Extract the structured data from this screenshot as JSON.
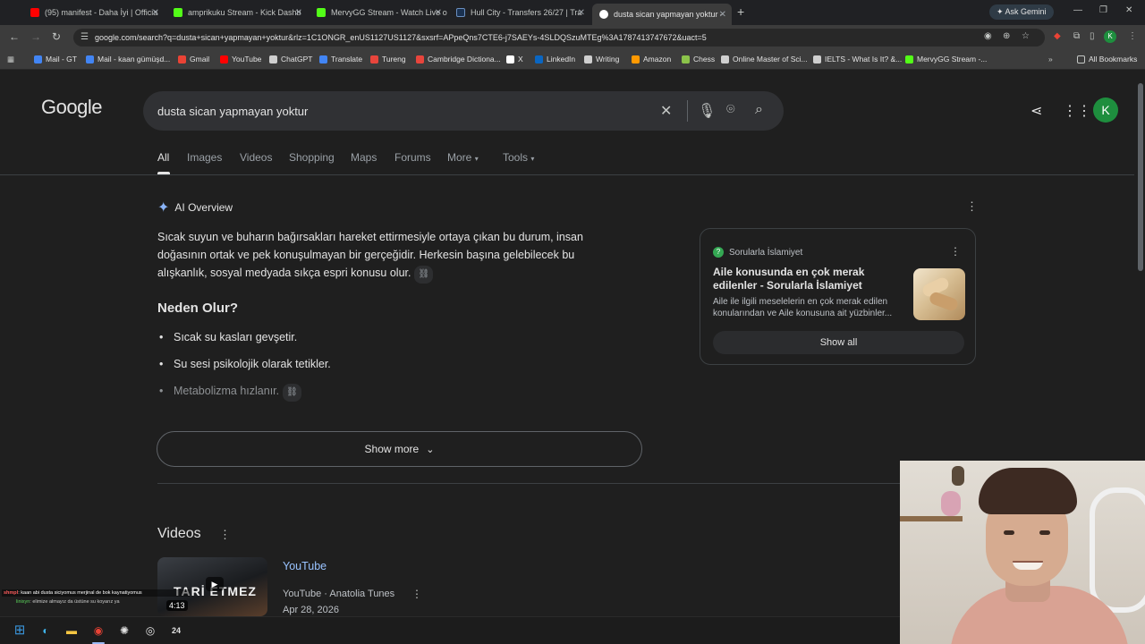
{
  "browser": {
    "tabs": [
      {
        "title": "(95) manifest - Daha İyi | Officia",
        "favicon_color": "#ff0000"
      },
      {
        "title": "amprikuku Stream - Kick Dashb",
        "favicon_color": "#53fc18"
      },
      {
        "title": "MervyGG Stream - Watch Live o",
        "favicon_color": "#53fc18"
      },
      {
        "title": "Hull City - Transfers 26/27 | Tra",
        "favicon_color": "#1a3150"
      },
      {
        "title": "dusta sican yapmayan yoktur -",
        "favicon_color": "#ffffff"
      }
    ],
    "new_tab_icon": "+",
    "ask_gemini": "Ask Gemini",
    "url": "google.com/search?q=dusta+sican+yapmayan+yoktur&rlz=1C1ONGR_enUS1127US1127&sxsrf=APpeQns7CTE6-j7SAEYs-4SLDQSzuMTEg%3A1787413747672&uact=5",
    "profile_initial": "K",
    "bookmarks": [
      {
        "label": "Mail - GT",
        "color": "#4285f4"
      },
      {
        "label": "Mail - kaan gümüşd...",
        "color": "#4285f4"
      },
      {
        "label": "Gmail",
        "color": "#ea4335"
      },
      {
        "label": "YouTube",
        "color": "#ff0000"
      },
      {
        "label": "ChatGPT",
        "color": "#cfcfcf"
      },
      {
        "label": "Translate",
        "color": "#4285f4"
      },
      {
        "label": "Tureng",
        "color": "#e8453c"
      },
      {
        "label": "Cambridge Dictiona...",
        "color": "#e8453c"
      },
      {
        "label": "X",
        "color": "#ffffff"
      },
      {
        "label": "LinkedIn",
        "color": "#0a66c2"
      },
      {
        "label": "Writing",
        "color": "#cfcfcf"
      },
      {
        "label": "Amazon",
        "color": "#ff9900"
      },
      {
        "label": "Chess",
        "color": "#8bc34a"
      },
      {
        "label": "Online Master of Sci...",
        "color": "#cfcfcf"
      },
      {
        "label": "IELTS - What Is It? &...",
        "color": "#cfcfcf"
      },
      {
        "label": "MervyGG Stream -...",
        "color": "#53fc18"
      }
    ],
    "all_bookmarks": "All Bookmarks"
  },
  "google": {
    "logo": "Google",
    "query": "dusta sican yapmayan yoktur",
    "profile_initial": "K",
    "tabs": [
      "All",
      "Images",
      "Videos",
      "Shopping",
      "Maps",
      "Forums",
      "More",
      "Tools"
    ],
    "active_tab": "All"
  },
  "ai_overview": {
    "label": "AI Overview",
    "paragraph": "Sıcak suyun ve buharın bağırsakları hareket ettirmesiyle ortaya çıkan bu durum, insan doğasının ortak ve pek konuşulmayan bir gerçeğidir. Herkesin başına gelebilecek bu alışkanlık, sosyal medyada sıkça espri konusu olur.",
    "heading": "Neden Olur?",
    "bullets": [
      "Sıcak su kasları gevşetir.",
      "Su sesi psikolojik olarak tetikler.",
      "Metabolizma hızlanır."
    ],
    "show_more": "Show more"
  },
  "source_card": {
    "site": "Sorularla İslamiyet",
    "title": "Aile konusunda en çok merak edilenler - Sorularla İslamiyet",
    "description": "Aile ile ilgili meselelerin en çok merak edilen konularından ve Aile konusuna ait yüzbinler...",
    "show_all": "Show all"
  },
  "videos": {
    "title": "Videos",
    "items": [
      {
        "thumb_text": "TARİ ETMEZ",
        "duration": "4:13",
        "source": "YouTube",
        "meta": "YouTube · Anatolia Tunes",
        "date": "Apr 28, 2026"
      }
    ]
  },
  "chat_overlay": {
    "line1_user": "shmpl",
    "line1_text": ": kaan abi dusta siciyomus merjinal de bok kaynatiyomus",
    "line2_user": "linixyn",
    "line2_text": ": elimize almayız da üstüne su koyarız ya"
  },
  "taskbar": {
    "icons": [
      "windows-icon",
      "edge-icon",
      "explorer-icon",
      "chrome-icon",
      "chatgpt-icon",
      "obs-icon",
      "app-24-icon"
    ],
    "app_24_label": "24"
  }
}
